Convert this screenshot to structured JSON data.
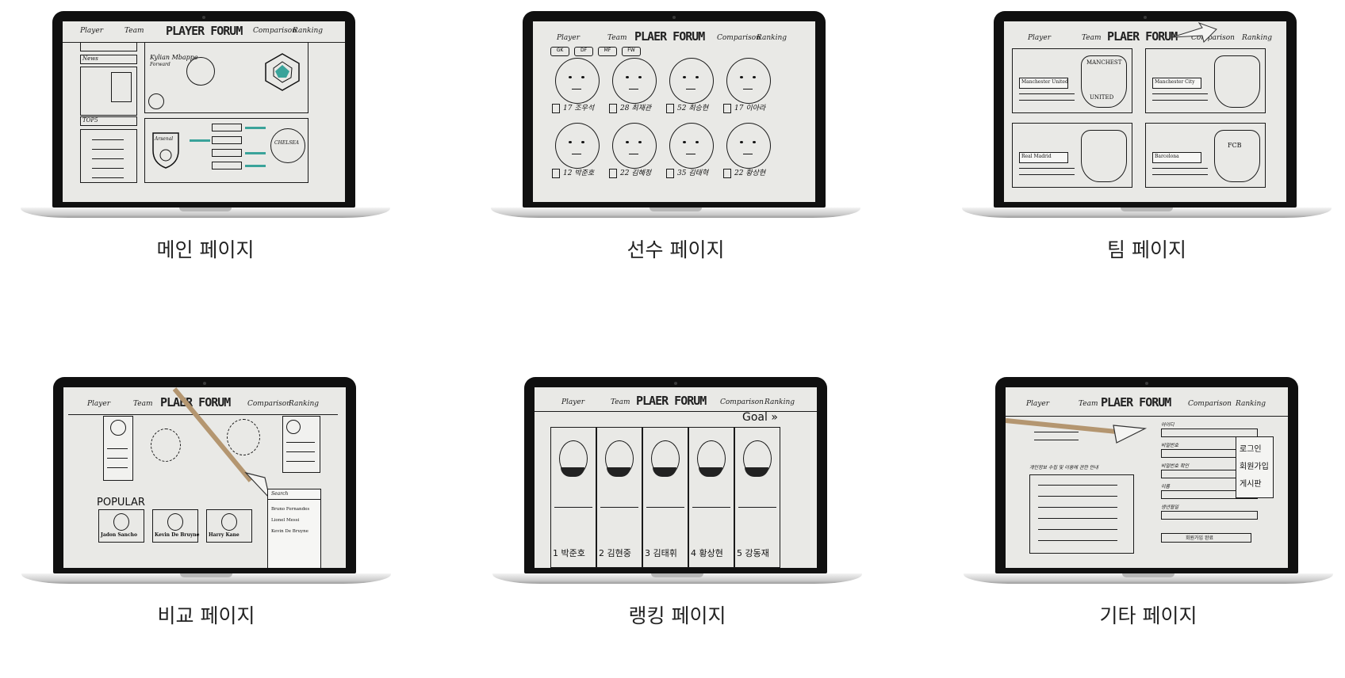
{
  "cells": [
    {
      "caption": "메인 페이지",
      "nav": {
        "left1": "Player",
        "left2": "Team",
        "brand": "PLAYER FORUM",
        "right1": "Comparison",
        "right2": "Ranking"
      },
      "texts": {
        "news": "News",
        "player_name": "Kylian Mbappe",
        "position": "Forward",
        "top5": "TOP5",
        "club_a": "Arsenal",
        "club_b": "CHELSEA"
      }
    },
    {
      "caption": "선수 페이지",
      "nav": {
        "left1": "Player",
        "left2": "Team",
        "brand": "PLAER FORUM",
        "right1": "Comparison",
        "right2": "Ranking"
      },
      "texts": {
        "filters": [
          "GK",
          "DF",
          "MF",
          "FW"
        ],
        "players": [
          "17 조우석",
          "28 최재관",
          "52 최승현",
          "17 이아라",
          "12 박준호",
          "22 김혜정",
          "35 김태혁",
          "22 황상현"
        ]
      }
    },
    {
      "caption": "팀 페이지",
      "nav": {
        "left1": "Player",
        "left2": "Team",
        "brand": "PLAER FORUM",
        "right1": "Comparison",
        "right2": "Ranking"
      },
      "texts": {
        "teams": [
          "Manchester United",
          "Manchester City",
          "Real Madrid",
          "Barcelona"
        ],
        "crest1": "MANCHEST",
        "crest1b": "UNITED",
        "crest4": "FCB"
      }
    },
    {
      "caption": "비교 페이지",
      "nav": {
        "left1": "Player",
        "left2": "Team",
        "brand": "PLAER FORUM",
        "right1": "Comparison",
        "right2": "Ranking"
      },
      "texts": {
        "popular": "POPULAR",
        "players": [
          "Jadon Sancho",
          "Kevin De Bruyne",
          "Harry Kane"
        ],
        "search": "Search",
        "results": [
          "Bruno Fernandes",
          "Lionel Messi",
          "Kevin De Bruyne"
        ]
      }
    },
    {
      "caption": "랭킹 페이지",
      "nav": {
        "left1": "Player",
        "left2": "Team",
        "brand": "PLAER FORUM",
        "right1": "Comparison",
        "right2": "Ranking"
      },
      "texts": {
        "goal": "Goal »",
        "ranks": [
          "1 박준호",
          "2 김현중",
          "3 김태휘",
          "4 황상현",
          "5 강동재"
        ]
      }
    },
    {
      "caption": "기타 페이지",
      "nav": {
        "left1": "Player",
        "left2": "Team",
        "brand": "PLAER FORUM",
        "right1": "Comparison",
        "right2": "Ranking"
      },
      "texts": {
        "buttons": [
          "로그인",
          "회원가입",
          "게시판"
        ],
        "notice": "개인정보 수집 및 이용에 관한 안내",
        "fields": [
          "아이디",
          "비밀번호",
          "비밀번호 확인",
          "이름",
          "생년월일"
        ],
        "submit": "회원가입 완료"
      }
    }
  ]
}
